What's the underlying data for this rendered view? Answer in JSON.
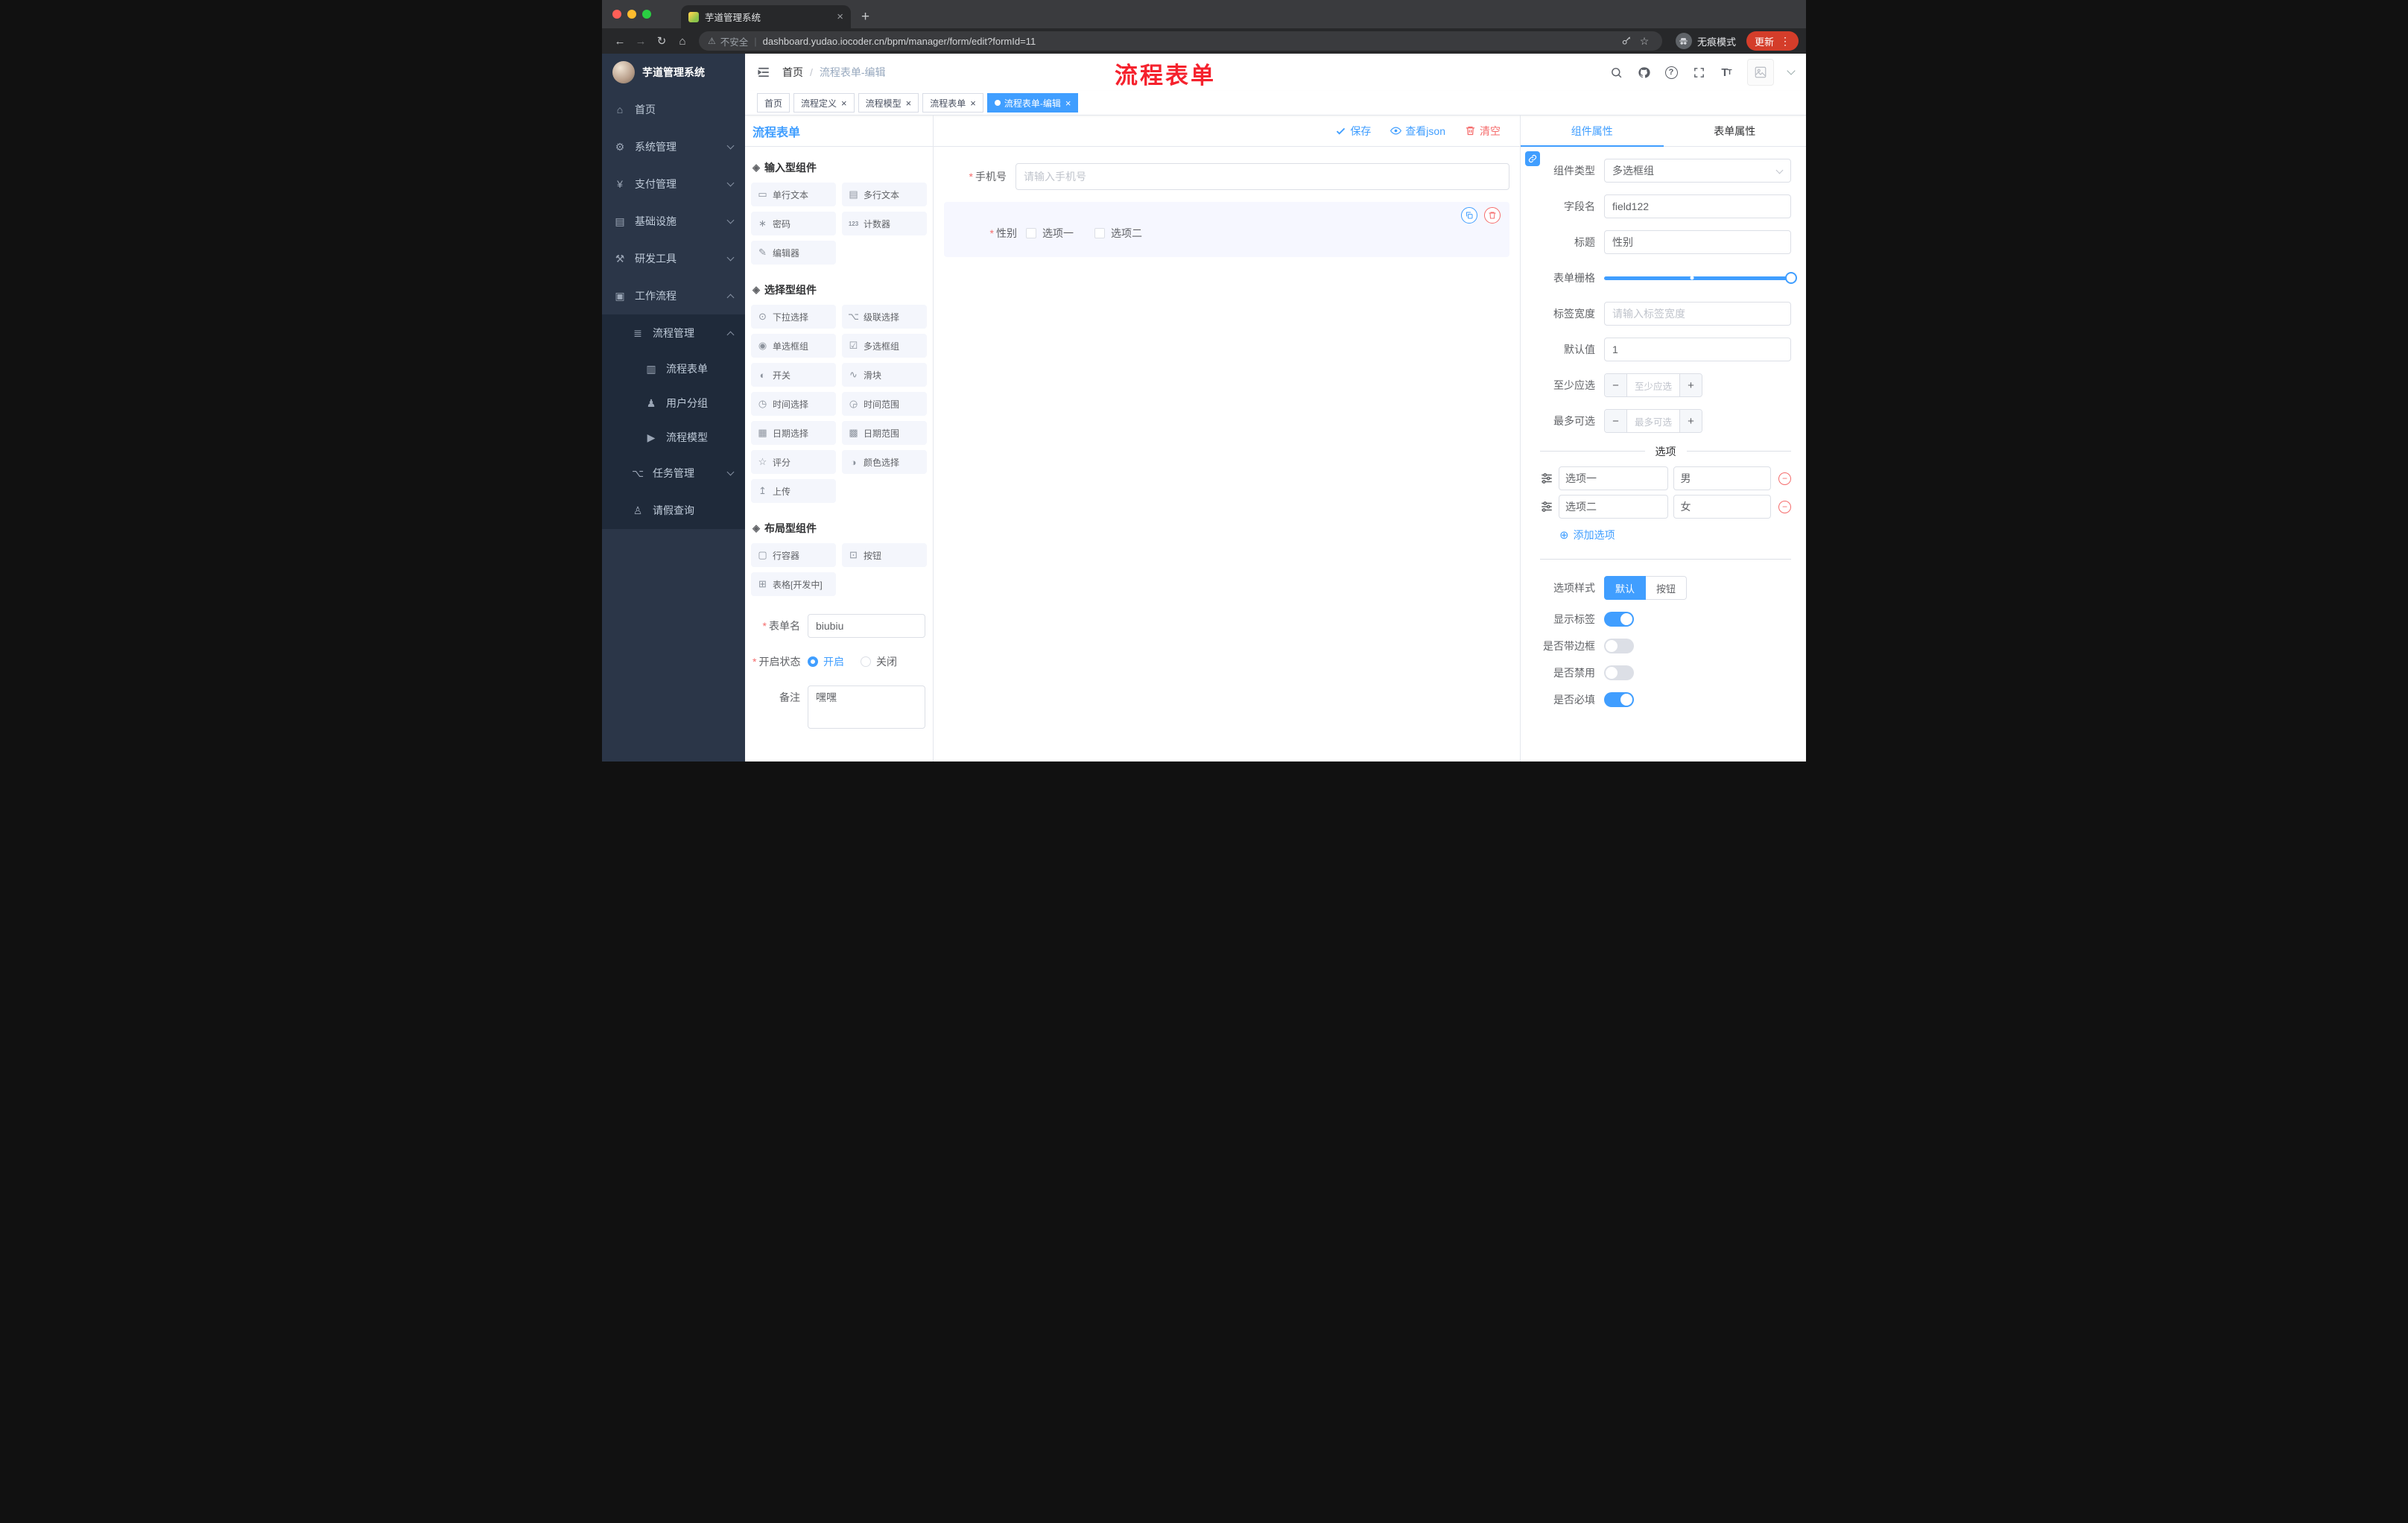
{
  "browser": {
    "tab_title": "芋道管理系统",
    "url": "dashboard.yudao.iocoder.cn/bpm/manager/form/edit?formId=11",
    "security_label": "不安全",
    "incognito_label": "无痕模式",
    "update_label": "更新"
  },
  "annotation": "流程表单",
  "sidebar": {
    "logo_title": "芋道管理系统",
    "items": [
      {
        "label": "首页"
      },
      {
        "label": "系统管理"
      },
      {
        "label": "支付管理"
      },
      {
        "label": "基础设施"
      },
      {
        "label": "研发工具"
      },
      {
        "label": "工作流程"
      }
    ],
    "submenu": [
      {
        "label": "流程管理"
      },
      {
        "label": "流程表单"
      },
      {
        "label": "用户分组"
      },
      {
        "label": "流程模型"
      },
      {
        "label": "任务管理"
      },
      {
        "label": "请假查询"
      }
    ]
  },
  "header": {
    "breadcrumb": [
      "首页",
      "流程表单-编辑"
    ]
  },
  "tags": [
    {
      "label": "首页",
      "closable": false,
      "active": false
    },
    {
      "label": "流程定义",
      "closable": true,
      "active": false
    },
    {
      "label": "流程模型",
      "closable": true,
      "active": false
    },
    {
      "label": "流程表单",
      "closable": true,
      "active": false
    },
    {
      "label": "流程表单-编辑",
      "closable": true,
      "active": true
    }
  ],
  "builder": {
    "title": "流程表单",
    "toolbar": {
      "save": "保存",
      "view_json": "查看json",
      "clear": "清空"
    },
    "palette": [
      {
        "title": "输入型组件",
        "items": [
          "单行文本",
          "多行文本",
          "密码",
          "计数器",
          "编辑器"
        ]
      },
      {
        "title": "选择型组件",
        "items": [
          "下拉选择",
          "级联选择",
          "单选框组",
          "多选框组",
          "开关",
          "滑块",
          "时间选择",
          "时间范围",
          "日期选择",
          "日期范围",
          "评分",
          "颜色选择",
          "上传"
        ]
      },
      {
        "title": "布局型组件",
        "items": [
          "行容器",
          "按钮",
          "表格[开发中]"
        ]
      }
    ],
    "meta": {
      "form_name_label": "表单名",
      "form_name_value": "biubiu",
      "status_label": "开启状态",
      "status_options": [
        "开启",
        "关闭"
      ],
      "status_selected": "开启",
      "remark_label": "备注",
      "remark_value": "嘿嘿"
    }
  },
  "canvas": {
    "phone": {
      "label": "手机号",
      "placeholder": "请输入手机号",
      "required": true
    },
    "gender": {
      "label": "性别",
      "required": true,
      "options": [
        "选项一",
        "选项二"
      ]
    }
  },
  "inspector": {
    "tabs": [
      "组件属性",
      "表单属性"
    ],
    "active_tab": "组件属性",
    "fields": {
      "component_type": {
        "label": "组件类型",
        "value": "多选框组"
      },
      "field_name": {
        "label": "字段名",
        "value": "field122"
      },
      "title": {
        "label": "标题",
        "value": "性别"
      },
      "grid": {
        "label": "表单栅格"
      },
      "label_width": {
        "label": "标签宽度",
        "placeholder": "请输入标签宽度"
      },
      "default_value": {
        "label": "默认值",
        "value": "1"
      },
      "min_select": {
        "label": "至少应选",
        "placeholder": "至少应选"
      },
      "max_select": {
        "label": "最多可选",
        "placeholder": "最多可选"
      }
    },
    "options": {
      "divider": "选项",
      "rows": [
        {
          "label": "选项一",
          "value": "男"
        },
        {
          "label": "选项二",
          "value": "女"
        }
      ],
      "add": "添加选项"
    },
    "style": {
      "label": "选项样式",
      "options": [
        "默认",
        "按钮"
      ],
      "selected": "默认"
    },
    "switches": [
      {
        "label": "显示标签",
        "on": true
      },
      {
        "label": "是否带边框",
        "on": false
      },
      {
        "label": "是否禁用",
        "on": false
      },
      {
        "label": "是否必填",
        "on": true
      }
    ]
  },
  "colors": {
    "accent": "#409EFF",
    "danger": "#F56C6C",
    "active_tag": "#409EFF",
    "annotation_red": "#f5222d",
    "sidebar_bg": "#2b3648",
    "submenu_bg": "#1f2a3a"
  }
}
